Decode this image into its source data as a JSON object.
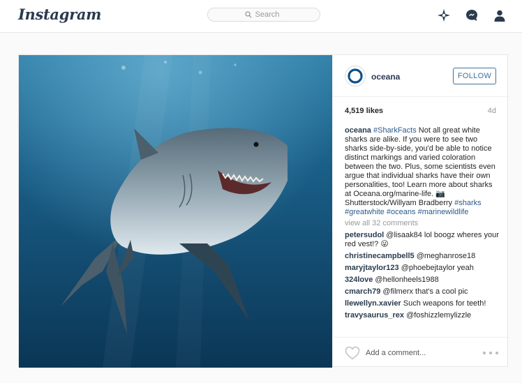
{
  "app": {
    "logo": "Instagram"
  },
  "search": {
    "placeholder": "Search"
  },
  "nav": {
    "icons": [
      "explore-icon",
      "activity-icon",
      "profile-icon"
    ]
  },
  "post": {
    "username": "oceana",
    "follow_label": "FOLLOW",
    "likes": "4,519 likes",
    "age": "4d",
    "caption": {
      "user": "oceana",
      "hashtag_lead": "#SharkFacts",
      "body": " Not all great white sharks are alike. If you were to see two sharks side-by-side, you'd be able to notice distinct markings and varied coloration between the two. Plus, some scientists even argue that individual sharks have their own personalities, too! Learn more about sharks at Oceana.org/marine-life. 📷 Shutterstock/Willyam Bradberry ",
      "hashtags_tail": "#sharks #greatwhite #oceans #marinewildlife"
    },
    "view_all": "view all 32 comments",
    "comments": [
      {
        "user": "petersudol",
        "text": " @lisaak84 lol boogz wheres your red vest!? 😜"
      },
      {
        "user": "christinecampbell5",
        "text": " @meghanrose18"
      },
      {
        "user": "maryjtaylor123",
        "text": " @phoebejtaylor yeah"
      },
      {
        "user": "324love",
        "text": " @hellonheels1988"
      },
      {
        "user": "cmarch79",
        "text": " @filmerx that's a cool pic"
      },
      {
        "user": "llewellyn.xavier",
        "text": " Such weapons for teeth!"
      },
      {
        "user": "travysaurus_rex",
        "text": " @foshizzlemylizzle"
      }
    ],
    "add_comment_placeholder": "Add a comment..."
  },
  "colors": {
    "link": "#3f729b",
    "username": "#2a3b4f",
    "muted": "#999999",
    "border": "#efefef"
  }
}
